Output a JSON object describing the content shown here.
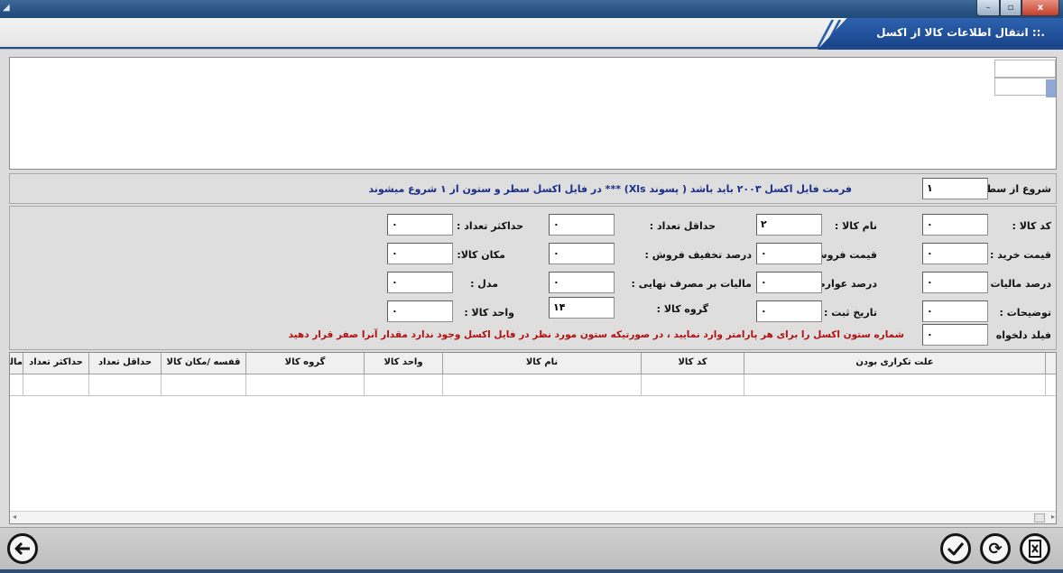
{
  "window": {
    "title": ".:: انتقال اطلاعات کالا از اکسل",
    "minimize_label": "–",
    "maximize_label": "▫",
    "close_label": "x"
  },
  "start_row": {
    "label": "شروع از سطر :",
    "value": "۱",
    "note": "فرمت فایل اکسل ۲۰۰۳ باید باشد ( پسوند Xls)  ***  در فایل اکسل سطر و ستون از ۱ شروع میشوند"
  },
  "fields": {
    "col1": [
      {
        "label": "کد کالا :",
        "value": "۰"
      },
      {
        "label": "قیمت خرید :",
        "value": "۰"
      },
      {
        "label": "درصد مالیات :",
        "value": "۰"
      },
      {
        "label": "توضیحات :",
        "value": "۰"
      },
      {
        "label": "فیلد دلخواه",
        "value": "۰"
      }
    ],
    "col2": [
      {
        "label": "نام کالا :",
        "value": "۲"
      },
      {
        "label": "قیمت فروش :",
        "value": "۰"
      },
      {
        "label": "درصد عوارض :",
        "value": "۰"
      },
      {
        "label": "تاریخ ثبت :",
        "value": "۰"
      }
    ],
    "col3": [
      {
        "label": "حداقل تعداد :",
        "value": "۰"
      },
      {
        "label": "درصد تخفیف فروش :",
        "value": "۰"
      },
      {
        "label": "مالیات بر مصرف نهایی :",
        "value": "۰"
      },
      {
        "label": "گروه کالا :",
        "value": "۱۴"
      }
    ],
    "col4": [
      {
        "label": "حداکثر تعداد :",
        "value": "۰"
      },
      {
        "label": "مکان کالا:",
        "value": "۰"
      },
      {
        "label": "مدل :",
        "value": "۰"
      },
      {
        "label": "واحد کالا :",
        "value": "۰"
      }
    ],
    "hint": "شماره ستون اکسل را برای هر پارامتر وارد نمایید ، در صورتیکه ستون  مورد نظر در فایل اکسل وجود ندارد مقدار آنرا صفر قرار دهید"
  },
  "grid": {
    "columns": [
      "علت تکراری بودن",
      "کد کالا",
      "نام کالا",
      "واحد کالا",
      "گروه کالا",
      "قفسه /مکان کالا",
      "حداقل تعداد",
      "حداکثر تعداد",
      "مالی"
    ]
  },
  "toolbar": {
    "back_icon": "arrow-left-circle-icon",
    "confirm_icon": "check-circle-icon",
    "refresh_icon": "refresh-circle-icon",
    "excel_icon": "excel-file-icon"
  }
}
